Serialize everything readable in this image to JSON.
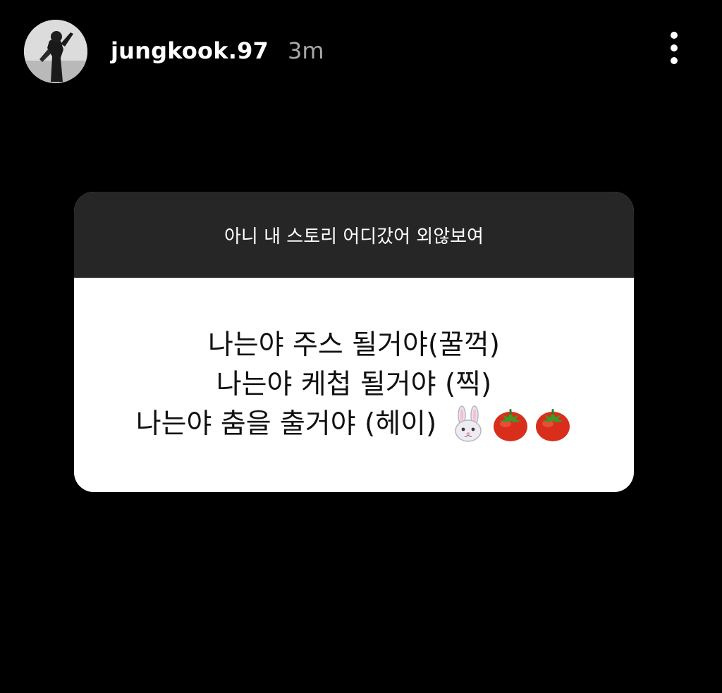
{
  "header": {
    "username": "jungkook.97",
    "timestamp": "3m",
    "avatar_icon": "profile-photo",
    "more_icon": "more-vertical-icon"
  },
  "question_card": {
    "question": "아니 내 스토리 어디갔어 외않보여",
    "answer_lines": [
      "나는야 주스 될거야(꿀꺽)",
      "나는야 케첩 될거야 (찍)",
      "나는야 춤을 출거야 (헤이)"
    ],
    "emojis": [
      "rabbit-face-icon",
      "tomato-icon",
      "tomato-icon"
    ]
  },
  "colors": {
    "background": "#000000",
    "card_header": "#262626",
    "card_body": "#ffffff",
    "timestamp": "#a8a8a8"
  }
}
